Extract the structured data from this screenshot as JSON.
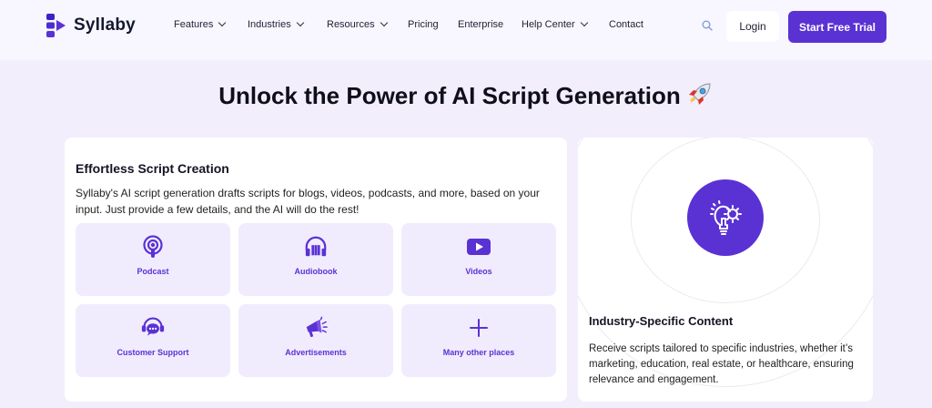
{
  "brand": {
    "name": "Syllaby",
    "accent": "#5a32d4"
  },
  "nav": {
    "items": [
      {
        "label": "Features",
        "dropdown": true
      },
      {
        "label": "Industries",
        "dropdown": true
      },
      {
        "label": "Resources",
        "dropdown": true
      },
      {
        "label": "Pricing",
        "dropdown": false
      },
      {
        "label": "Enterprise",
        "dropdown": false
      },
      {
        "label": "Help Center",
        "dropdown": true
      },
      {
        "label": "Contact",
        "dropdown": false
      }
    ],
    "search_icon": "search-icon",
    "login_label": "Login",
    "trial_label": "Start Free Trial"
  },
  "hero": {
    "title": "Unlock the Power of AI Script Generation",
    "emoji_icon": "rocket-icon"
  },
  "script_card": {
    "title": "Effortless Script Creation",
    "description": "Syllaby's AI script generation drafts scripts for blogs, videos, podcasts, and more, based on your input. Just provide a few details, and the AI will do the rest!",
    "tiles": [
      {
        "label": "Podcast",
        "icon": "podcast-icon"
      },
      {
        "label": "Audiobook",
        "icon": "audiobook-icon"
      },
      {
        "label": "Videos",
        "icon": "video-icon"
      },
      {
        "label": "Customer Support",
        "icon": "support-chat-icon"
      },
      {
        "label": "Advertisements",
        "icon": "megaphone-icon"
      },
      {
        "label": "Many other places",
        "icon": "plus-icon"
      }
    ]
  },
  "industry_card": {
    "icon": "lightbulb-gear-icon",
    "title": "Industry-Specific Content",
    "description": "Receive scripts tailored to specific industries, whether it’s marketing, education, real estate, or healthcare, ensuring relevance and engagement."
  }
}
